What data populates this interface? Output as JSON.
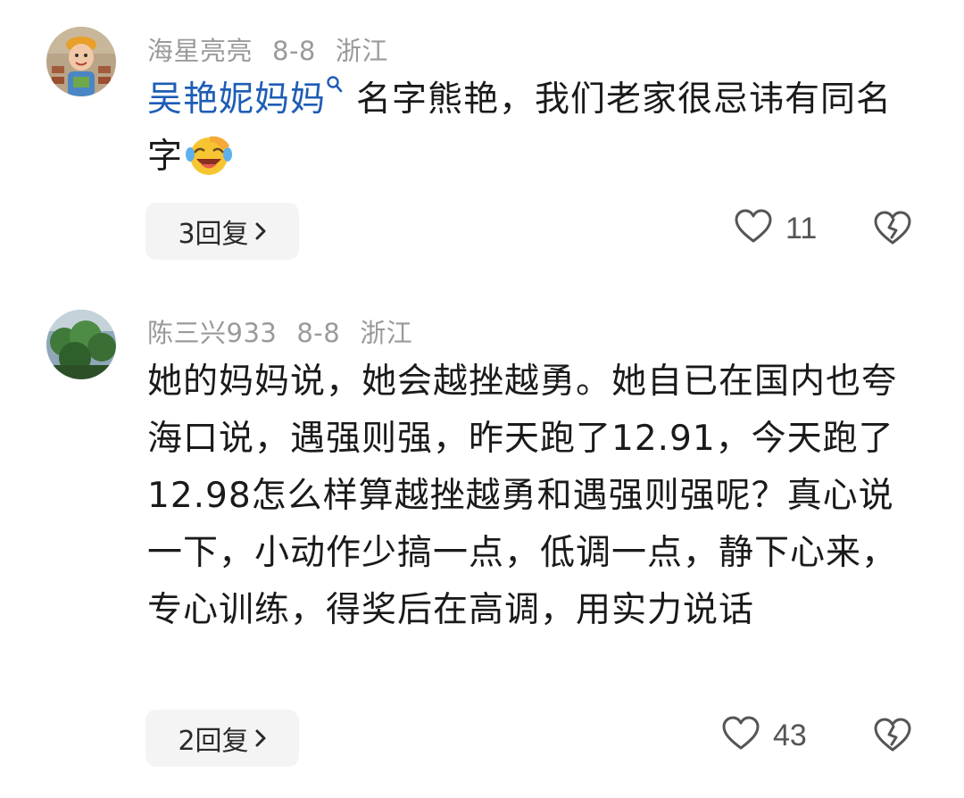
{
  "comments": [
    {
      "username": "海星亮亮",
      "date": "8-8",
      "location": "浙江",
      "mention": "吴艳妮妈妈",
      "text": "名字熊艳，我们老家很忌讳有同名字",
      "emoji": "laughing-crying-emoji",
      "replies": "3回复",
      "likes": "11"
    },
    {
      "username": "陈三兴933",
      "date": "8-8",
      "location": "浙江",
      "text": "她的妈妈说，她会越挫越勇。她自已在国内也夸海口说，遇强则强，昨天跑了12.91，今天跑了12.98怎么样算越挫越勇和遇强则强呢？真心说一下，小动作少搞一点，低调一点，静下心来，专心训练，得奖后在高调，用实力说话",
      "replies": "2回复",
      "likes": "43"
    }
  ],
  "colors": {
    "mention": "#1e5db6",
    "meta": "#9a9a9a",
    "reply_bg": "#f4f4f5"
  },
  "icons": {
    "like": "heart-outline-icon",
    "dislike": "broken-heart-icon",
    "chevron": "chevron-right-icon",
    "mention": "search-icon"
  }
}
